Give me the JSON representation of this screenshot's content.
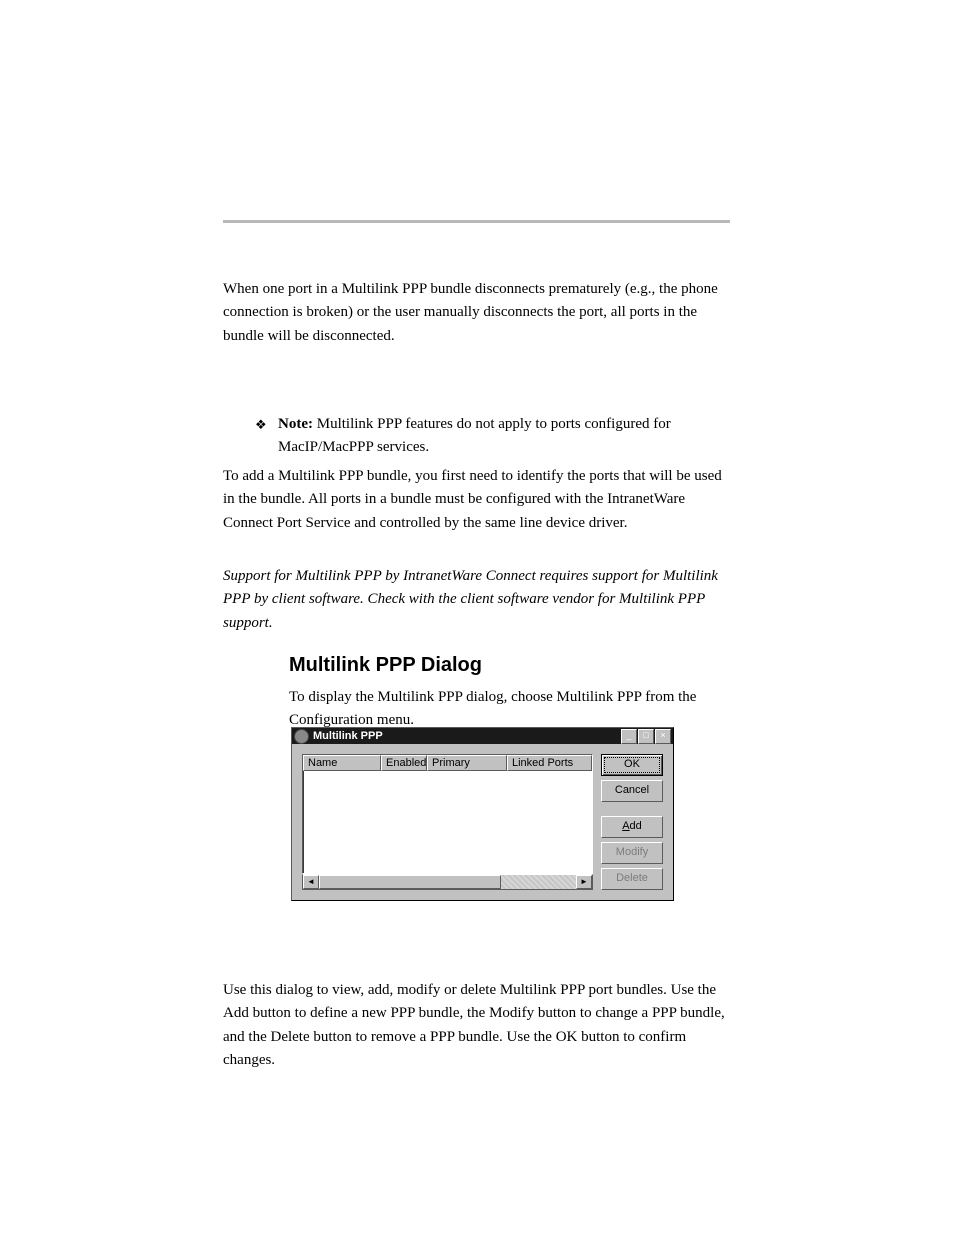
{
  "para1": "When one port in a Multilink PPP bundle disconnects prematurely (e.g., the phone connection is broken) or the user manually disconnects the port, all ports in the bundle will be disconnected.",
  "note_label": "Note:",
  "note_body": " Multilink PPP features do not apply to ports configured for MacIP/MacPPP services.",
  "para3": "To add a Multilink PPP bundle, you first need to identify the ports that will be used in the bundle. All ports in a bundle must be configured with the IntranetWare Connect Port Service and controlled by the same line device driver.",
  "para4": "Support for Multilink PPP by IntranetWare Connect requires support for Multilink PPP by client software. Check with the client software vendor for Multilink PPP support.",
  "heading": "Multilink PPP Dialog",
  "para5": "To display the Multilink PPP dialog, choose Multilink PPP from the Configuration menu.",
  "window": {
    "title": "Multilink PPP",
    "columns": {
      "name": "Name",
      "enabled": "Enabled",
      "primary": "Primary",
      "linked": "Linked Ports"
    },
    "buttons": {
      "ok": "OK",
      "cancel": "Cancel",
      "add_pre": "",
      "add_u": "A",
      "add_post": "dd",
      "modify": "Modify",
      "delete": "Delete"
    },
    "titlebar_icons": {
      "min": "_",
      "max": "□",
      "close": "×"
    },
    "scroll": {
      "left": "◄",
      "right": "►"
    }
  },
  "para6": "Use this dialog to view, add, modify or delete Multilink PPP port bundles. Use the Add button to define a new PPP bundle, the Modify button to change a PPP bundle, and the Delete button to remove a PPP bundle. Use the OK button to confirm changes."
}
